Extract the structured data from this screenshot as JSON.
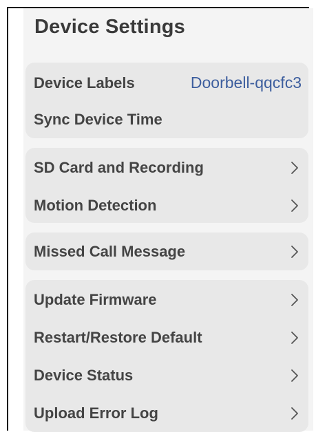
{
  "page": {
    "title": "Device Settings"
  },
  "sections": [
    {
      "items": [
        {
          "label": "Device Labels",
          "value": "Doorbell-qqcfc3",
          "has_chevron": false
        },
        {
          "label": "Sync Device Time",
          "has_chevron": false
        }
      ]
    },
    {
      "items": [
        {
          "label": "SD Card and Recording",
          "has_chevron": true
        },
        {
          "label": "Motion Detection",
          "has_chevron": true
        }
      ]
    },
    {
      "items": [
        {
          "label": "Missed Call Message",
          "has_chevron": true
        }
      ]
    },
    {
      "items": [
        {
          "label": "Update Firmware",
          "has_chevron": true
        },
        {
          "label": "Restart/Restore Default",
          "has_chevron": true
        },
        {
          "label": "Device Status",
          "has_chevron": true
        },
        {
          "label": "Upload Error Log",
          "has_chevron": true
        }
      ]
    }
  ],
  "icons": {
    "row_chevron": "chevron-right-icon"
  },
  "colors": {
    "background": "#f4f4f4",
    "card": "#e8e8e8",
    "label_text": "#444444",
    "value_text": "#3d5e9e"
  }
}
